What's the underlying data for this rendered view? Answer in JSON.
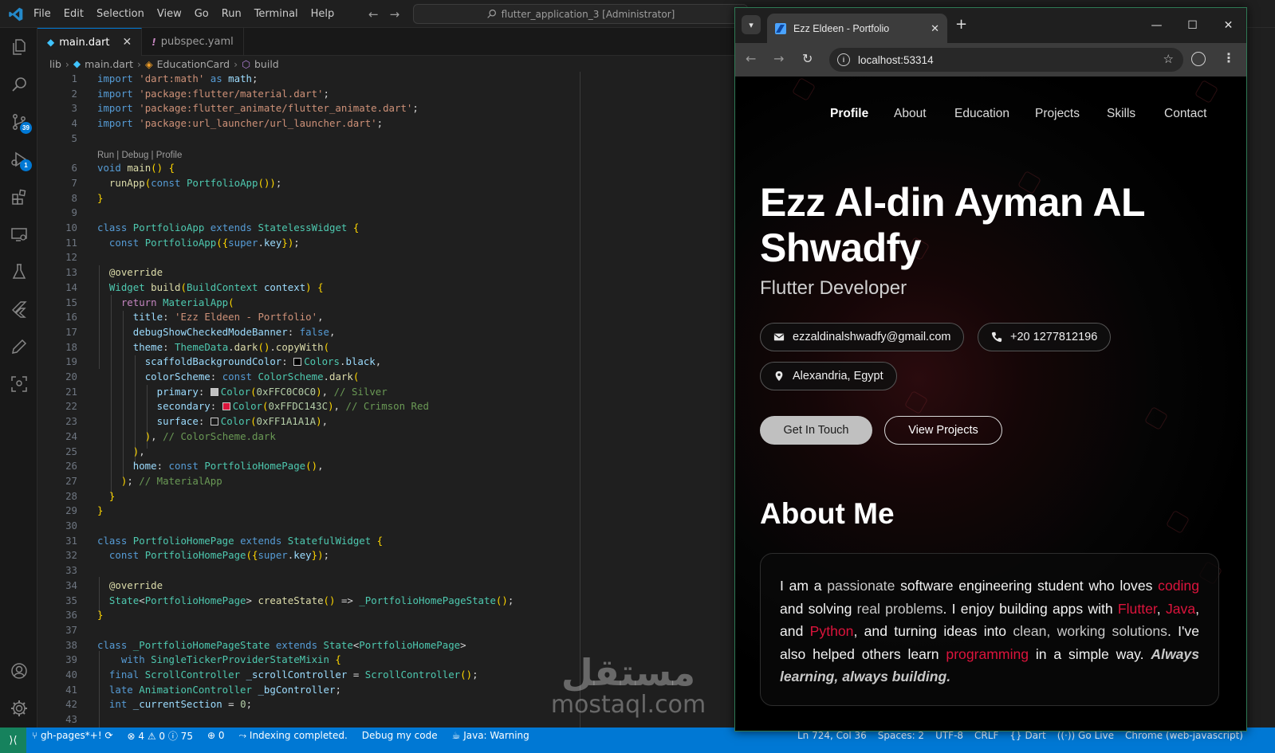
{
  "titlebar": {
    "menu": [
      "File",
      "Edit",
      "Selection",
      "View",
      "Go",
      "Run",
      "Terminal",
      "Help"
    ],
    "command_center": "flutter_application_3 [Administrator]"
  },
  "activity": {
    "scm_badge": "39",
    "debug_badge": "1"
  },
  "tabs": [
    {
      "label": "main.dart",
      "active": true
    },
    {
      "label": "pubspec.yaml",
      "active": false
    }
  ],
  "breadcrumb": [
    "lib",
    "main.dart",
    "EducationCard",
    "build"
  ],
  "code": {
    "codelens": "Run | Debug | Profile",
    "line_numbers": [
      "1",
      "2",
      "3",
      "4",
      "5",
      "6",
      "7",
      "8",
      "9",
      "10",
      "11",
      "12",
      "13",
      "14",
      "15",
      "16",
      "17",
      "18",
      "19",
      "20",
      "21",
      "22",
      "23",
      "24",
      "25",
      "26",
      "27",
      "28",
      "29",
      "30",
      "31",
      "32",
      "33",
      "34",
      "35",
      "36",
      "37",
      "38",
      "39",
      "40",
      "41",
      "42",
      "43"
    ],
    "lines": [
      "import 'dart:math' as math;",
      "import 'package:flutter/material.dart';",
      "import 'package:flutter_animate/flutter_animate.dart';",
      "import 'package:url_launcher/url_launcher.dart';",
      "",
      "void main() {",
      "  runApp(const PortfolioApp());",
      "}",
      "",
      "class PortfolioApp extends StatelessWidget {",
      "  const PortfolioApp({super.key});",
      "",
      "  @override",
      "  Widget build(BuildContext context) {",
      "    return MaterialApp(",
      "      title: 'Ezz Eldeen - Portfolio',",
      "      debugShowCheckedModeBanner: false,",
      "      theme: ThemeData.dark().copyWith(",
      "        scaffoldBackgroundColor: Colors.black,",
      "        colorScheme: const ColorScheme.dark(",
      "          primary: Color(0xFFC0C0C0), // Silver",
      "          secondary: Color(0xFFDC143C), // Crimson Red",
      "          surface: Color(0xFF1A1A1A),",
      "        ), // ColorScheme.dark",
      "      ),",
      "      home: const PortfolioHomePage(),",
      "    ); // MaterialApp",
      "  }",
      "}",
      "",
      "class PortfolioHomePage extends StatefulWidget {",
      "  const PortfolioHomePage({super.key});",
      "",
      "  @override",
      "  State<PortfolioHomePage> createState() => _PortfolioHomePageState();",
      "}",
      "",
      "class _PortfolioHomePageState extends State<PortfolioHomePage>",
      "    with SingleTickerProviderStateMixin {",
      "  final ScrollController _scrollController = ScrollController();",
      "  late AnimationController _bgController;",
      "  int _currentSection = 0;",
      ""
    ]
  },
  "swatches": {
    "scaffold": "#000000",
    "primary": "#C0C0C0",
    "secondary": "#DC143C",
    "surface": "#1A1A1A"
  },
  "watermark": {
    "arabic": "مستقل",
    "latin": "mostaql.com"
  },
  "statusbar": {
    "branch": "gh-pages*+!",
    "problems": "⊗ 4 ⚠ 0 ⓘ 75",
    "ports": "0",
    "indexing": "Indexing completed.",
    "debug": "Debug my code",
    "java": "Java: Warning",
    "position": "Ln 724, Col 36",
    "spaces": "Spaces: 2",
    "encoding": "UTF-8",
    "eol": "CRLF",
    "language": "Dart",
    "golive": "Go Live",
    "device": "Chrome (web-javascript)"
  },
  "browser": {
    "tab_title": "Ezz Eldeen - Portfolio",
    "url": "localhost:53314"
  },
  "portfolio": {
    "nav": [
      "Profile",
      "About",
      "Education",
      "Projects",
      "Skills",
      "Contact"
    ],
    "name": "Ezz Al-din Ayman AL Shwadfy",
    "role": "Flutter Developer",
    "email": "ezzaldinalshwadfy@gmail.com",
    "phone": "+20 1277812196",
    "location": "Alexandria, Egypt",
    "btn_primary": "Get In Touch",
    "btn_secondary": "View Projects",
    "about_title": "About Me",
    "about": {
      "p1": "I am a ",
      "h1": "passionate",
      "p2": " software engineering student who loves ",
      "r1": "coding",
      "p3": " and solving ",
      "h2": "real problems",
      "p4": ". I enjoy building apps with ",
      "r2": "Flutter",
      "p5": ", ",
      "r3": "Java",
      "p6": ", and ",
      "r4": "Python",
      "p7": ", and turning ideas into ",
      "h3": "clean, working solutions",
      "p8": ". I've also helped others learn ",
      "r5": "programming",
      "p9": " in a simple way. ",
      "em": "Always learning, always building."
    },
    "colors": {
      "accent": "#DC143C",
      "silver": "#C0C0C0",
      "background": "#000000"
    }
  }
}
